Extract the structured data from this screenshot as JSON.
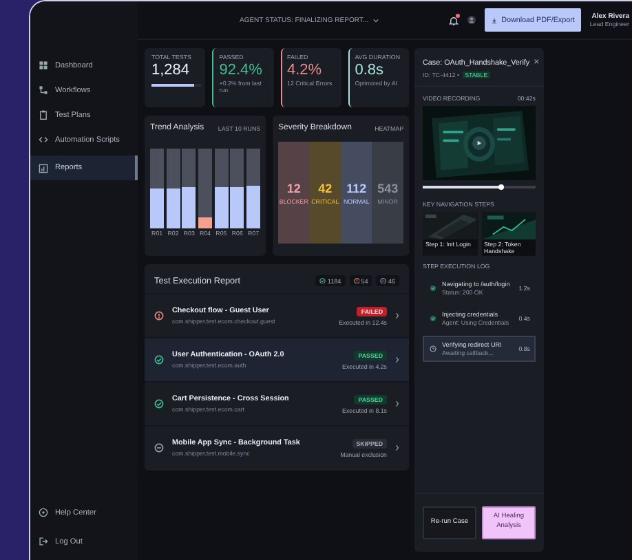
{
  "top_bar": {
    "status": "AGENT STATUS: FINALIZING REPORT...",
    "notification": true,
    "download_button": "Download PDF/Export",
    "user": {
      "name": "Alex Rivera",
      "role": "Lead Engineer"
    }
  },
  "sidebar": {
    "items": [
      {
        "label": "Dashboard",
        "selected": false
      },
      {
        "label": "Workflows",
        "selected": false
      },
      {
        "label": "Test Plans",
        "selected": false
      },
      {
        "label": "Automation Scripts",
        "selected": false
      },
      {
        "label": "Reports",
        "selected": true
      }
    ],
    "footer": [
      {
        "label": "Help Center"
      },
      {
        "label": "Log Out"
      }
    ]
  },
  "stats": [
    {
      "label": "TOTAL TESTS",
      "value": "1,284",
      "kind": "bar",
      "level": 0.85,
      "color": "#b8c8f8"
    },
    {
      "label": "PASSED",
      "value": "92.4%",
      "note": "+0.2% from last run",
      "kind": "accent",
      "color": "#3fbf8f"
    },
    {
      "label": "FAILED",
      "value": "4.2%",
      "note": "12 Critical Errors",
      "kind": "accent",
      "color": "#e88a8a"
    },
    {
      "label": "AVG DURATION",
      "value": "0.8s",
      "note": "Optimized by AI",
      "kind": "accent",
      "color": "#a8e0e0"
    }
  ],
  "trend": {
    "title": "Trend Analysis",
    "tag": "LAST 10 RUNS",
    "bars": [
      {
        "label": "R01",
        "level": 0.5,
        "color": "#b8c8f8"
      },
      {
        "label": "R02",
        "level": 0.5,
        "color": "#b8c8f8"
      },
      {
        "label": "R03",
        "level": 0.51,
        "color": "#b8c8f8"
      },
      {
        "label": "R04",
        "level": 0.14,
        "color": "#f4a08c"
      },
      {
        "label": "R05",
        "level": 0.51,
        "color": "#b8c8f8"
      },
      {
        "label": "R06",
        "level": 0.51,
        "color": "#b8c8f8"
      },
      {
        "label": "R07",
        "level": 0.53,
        "color": "#b8c8f8"
      }
    ]
  },
  "severity": {
    "title": "Severity Breakdown",
    "tag": "HEATMAP",
    "items": [
      {
        "count": "12",
        "label": "BLOCKER",
        "color": "#f0a0a0"
      },
      {
        "count": "42",
        "label": "CRITICAL",
        "color": "#f0c040"
      },
      {
        "count": "112",
        "label": "NORMAL",
        "color": "#b8c8f8"
      },
      {
        "count": "543",
        "label": "MINOR",
        "color": "#8a909c"
      }
    ]
  },
  "report": {
    "title": "Test Execution Report",
    "chips": [
      {
        "kind": "passed",
        "text": "1184"
      },
      {
        "kind": "failed",
        "text": "54"
      },
      {
        "kind": "skipped",
        "text": "46"
      }
    ],
    "rows": [
      {
        "title": "Checkout flow - Guest User",
        "path": "com.shipper.test.ecom.checkout.guest",
        "kind": "failed",
        "badge": "FAILED",
        "time": "Executed in 12.4s",
        "selected": false
      },
      {
        "title": "User Authentication - OAuth 2.0",
        "path": "com.shipper.test.ecom.auth",
        "kind": "passed",
        "badge": "PASSED",
        "time": "Executed in 4.2s",
        "selected": true
      },
      {
        "title": "Cart Persistence - Cross Session",
        "path": "com.shipper.test.ecom.cart",
        "kind": "passed",
        "badge": "PASSED",
        "time": "Executed in 8.1s",
        "selected": false
      },
      {
        "title": "Mobile App Sync - Background Task",
        "path": "com.shipper.test.mobile.sync",
        "kind": "skipped",
        "badge": "SKIPPED",
        "time": "Manual exclusion",
        "selected": false
      }
    ]
  },
  "panel": {
    "title": "Case: OAuth_Handshake_Verify",
    "close": "×",
    "id": "ID: TC-4412 •",
    "state": "STABLE",
    "video": {
      "label": "VIDEO RECORDING",
      "duration": "00:42s",
      "level": 0.7
    },
    "steps_label": "KEY NAVIGATION STEPS",
    "steps": [
      {
        "caption": "Step 1: Init Login"
      },
      {
        "caption": "Step 2: Token Handshake"
      }
    ],
    "log_label": "STEP EXECUTION LOG",
    "log": [
      {
        "title": "Navigating to /auth/login",
        "detail": "Status: 200 OK",
        "time": "1.2s",
        "selected": false
      },
      {
        "title": "Injecting credentials",
        "detail": "Agent: Using Credentials",
        "time": "0.4s",
        "selected": false
      },
      {
        "title": "Verifying redirect URI",
        "detail": "Awaiting callback...",
        "time": "0.8s",
        "selected": true
      }
    ],
    "buttons": [
      {
        "label": "Re-run Case",
        "kind": "secondary"
      },
      {
        "label": "AI Healing Analysis",
        "kind": "primary"
      }
    ]
  }
}
